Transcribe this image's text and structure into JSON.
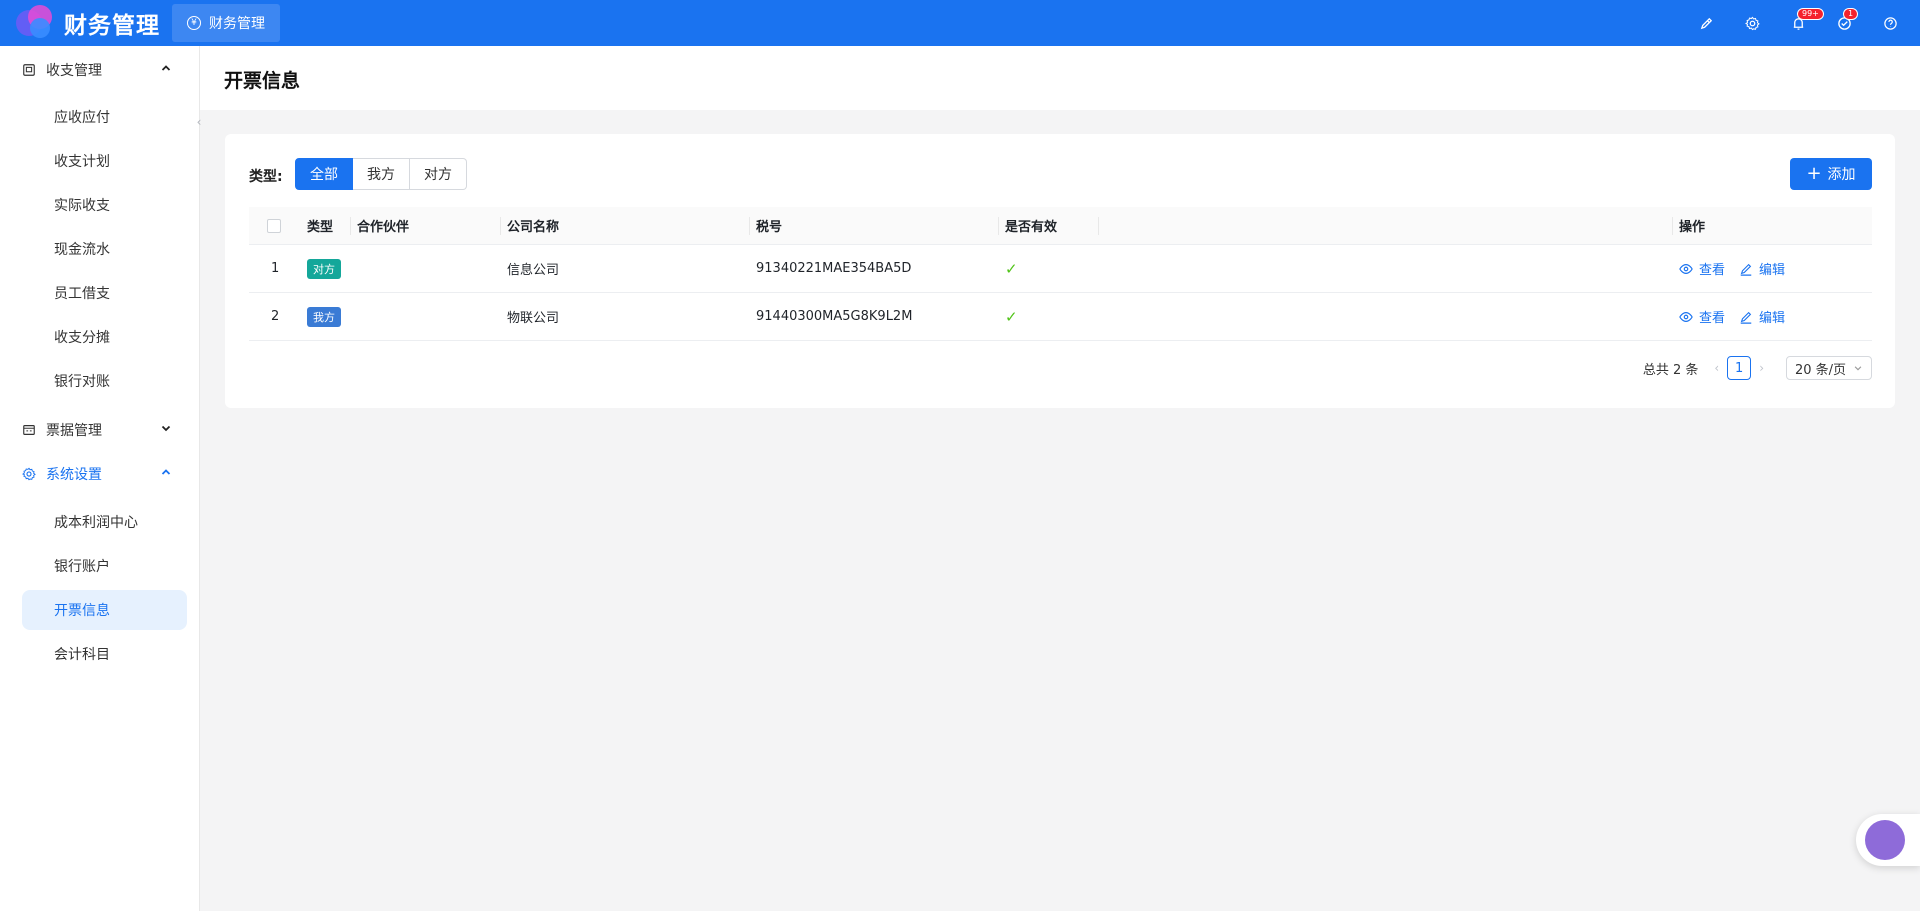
{
  "header": {
    "app_title": "财务管理",
    "tab_label": "财务管理",
    "notification_badge": "99+",
    "task_badge": "1"
  },
  "sidebar": {
    "groups": [
      {
        "label": "收支管理",
        "items": [
          "应收应付",
          "收支计划",
          "实际收支",
          "现金流水",
          "员工借支",
          "收支分摊",
          "银行对账"
        ]
      },
      {
        "label": "票据管理",
        "items": []
      },
      {
        "label": "系统设置",
        "items": [
          "成本利润中心",
          "银行账户",
          "开票信息",
          "会计科目"
        ]
      }
    ],
    "active_item": "开票信息"
  },
  "page": {
    "title": "开票信息"
  },
  "filter": {
    "label": "类型:",
    "options": [
      "全部",
      "我方",
      "对方"
    ],
    "selected": "全部"
  },
  "add_button": "添加",
  "table": {
    "headers": [
      "类型",
      "合作伙伴",
      "公司名称",
      "税号",
      "是否有效",
      "操作"
    ],
    "rows": [
      {
        "index": "1",
        "type": "对方",
        "partner": "",
        "company": "信息公司",
        "tax_id": "91340221MAE354BA5D",
        "valid": "✓",
        "view": "查看",
        "edit": "编辑"
      },
      {
        "index": "2",
        "type": "我方",
        "partner": "",
        "company": "物联公司",
        "tax_id": "91440300MA5G8K9L2M",
        "valid": "✓",
        "view": "查看",
        "edit": "编辑"
      }
    ]
  },
  "pagination": {
    "total_text": "总共 2 条",
    "current_page": "1",
    "page_size": "20 条/页"
  },
  "colors": {
    "primary": "#1a73f0",
    "tag_counterparty": "#14a79a",
    "tag_ours": "#3a7bd5",
    "valid_check": "#52c41a"
  }
}
